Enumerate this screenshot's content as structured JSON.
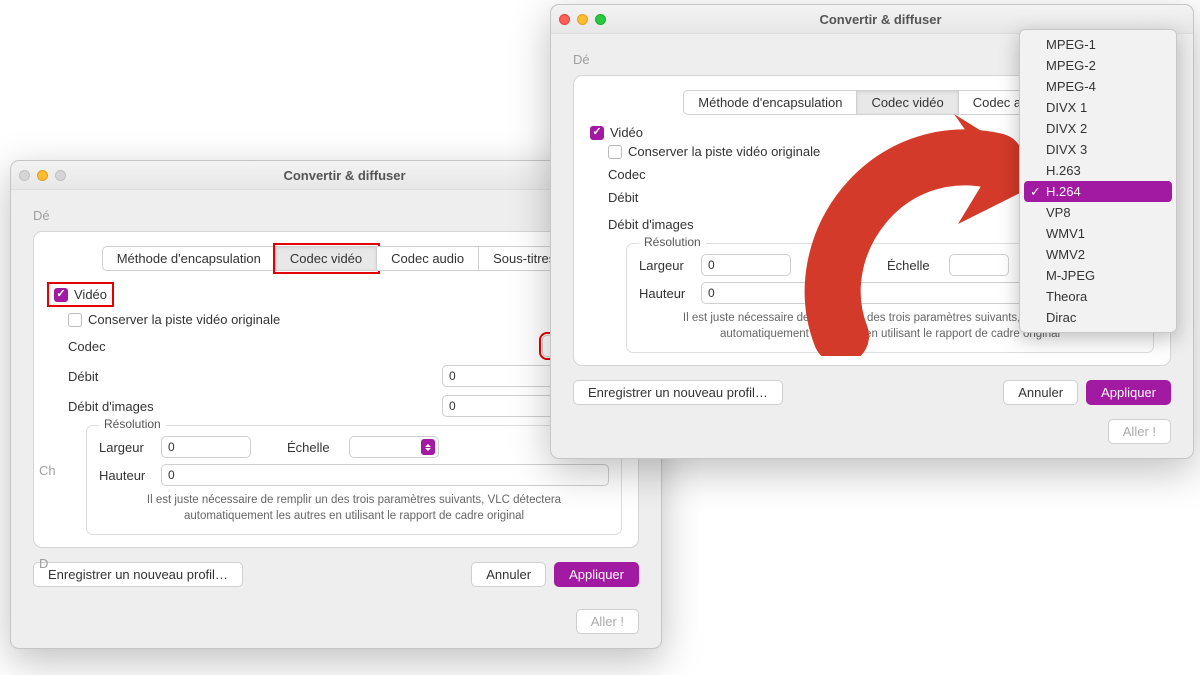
{
  "window_title": "Convertir & diffuser",
  "section_label_partial": "Dé",
  "tabs": {
    "encapsulation": "Méthode d'encapsulation",
    "video": "Codec vidéo",
    "audio": "Codec audio",
    "subs": "Sous-titres"
  },
  "video_check": "Vidéo",
  "keep_original": "Conserver la piste vidéo originale",
  "codec_label": "Codec",
  "codec_value": "H.264",
  "bitrate_label": "Débit",
  "bitrate_value": "0",
  "fps_label": "Débit d'images",
  "fps_value": "0",
  "resolution": {
    "legend": "Résolution",
    "width_lbl": "Largeur",
    "width_val": "0",
    "height_lbl": "Hauteur",
    "height_val": "0",
    "scale_lbl": "Échelle",
    "help": "Il est juste nécessaire de remplir un des trois paramètres suivants, VLC détectera automatiquement les autres en utilisant le rapport de cadre original"
  },
  "buttons": {
    "save_profile": "Enregistrer un nouveau profil…",
    "cancel": "Annuler",
    "apply": "Appliquer",
    "go": "Aller !"
  },
  "left_side_ch": "Ch",
  "left_side_d": "D",
  "codec_menu": [
    "MPEG-1",
    "MPEG-2",
    "MPEG-4",
    "DIVX 1",
    "DIVX 2",
    "DIVX 3",
    "H.263",
    "H.264",
    "VP8",
    "WMV1",
    "WMV2",
    "M-JPEG",
    "Theora",
    "Dirac"
  ],
  "codec_menu_selected": "H.264"
}
